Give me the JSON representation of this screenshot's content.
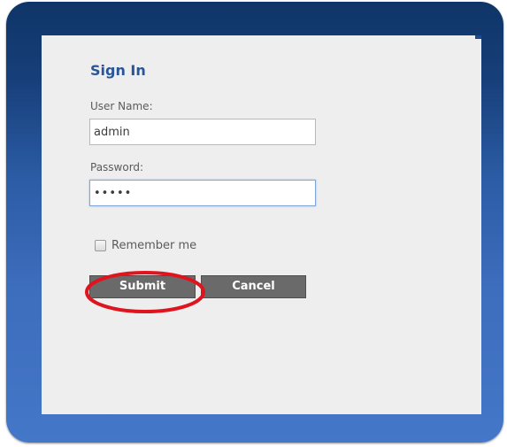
{
  "signin": {
    "title": "Sign In",
    "username_label": "User Name:",
    "username_value": "admin",
    "password_label": "Password:",
    "password_value": "•••••",
    "remember_label": "Remember me",
    "remember_checked": false,
    "submit_label": "Submit",
    "cancel_label": "Cancel"
  },
  "colors": {
    "frame_top": "#0f3568",
    "frame_bottom": "#4477c8",
    "panel_background": "#eeeeee",
    "title_color": "#2a5599",
    "button_background": "#6a6a6a",
    "highlight_circle": "#e0141e"
  }
}
